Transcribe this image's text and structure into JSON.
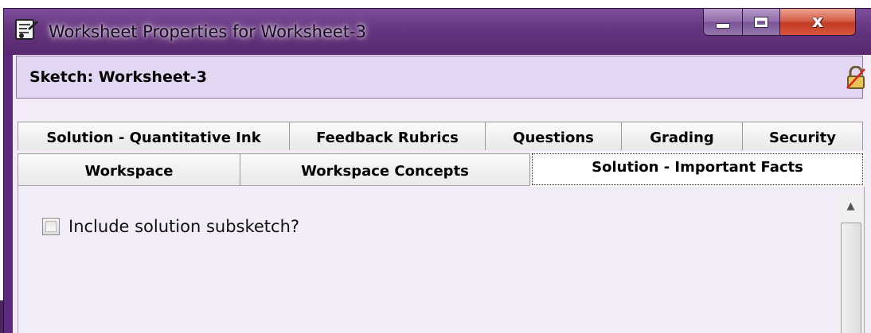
{
  "window": {
    "title": "Worksheet Properties for Worksheet-3",
    "icon": "worksheet-properties-icon",
    "controls": {
      "minimize": "minimize-icon",
      "maximize": "maximize-icon",
      "close": "x"
    }
  },
  "header": {
    "title": "Sketch: Worksheet-3",
    "lock_icon": "unlocked-padlock-icon"
  },
  "tabs": {
    "row1": [
      "Solution - Quantitative Ink",
      "Feedback Rubrics",
      "Questions",
      "Grading",
      "Security"
    ],
    "row2": [
      "Workspace",
      "Workspace Concepts",
      "Solution - Important Facts"
    ],
    "active": "Solution - Important Facts"
  },
  "page": {
    "checkbox_label": "Include solution subsketch?",
    "checkbox_checked": false
  },
  "colors": {
    "titlebar": "#65357f",
    "header_panel": "#e3d6f3",
    "content_bg": "#f3edf9",
    "close_button": "#c23a22"
  }
}
